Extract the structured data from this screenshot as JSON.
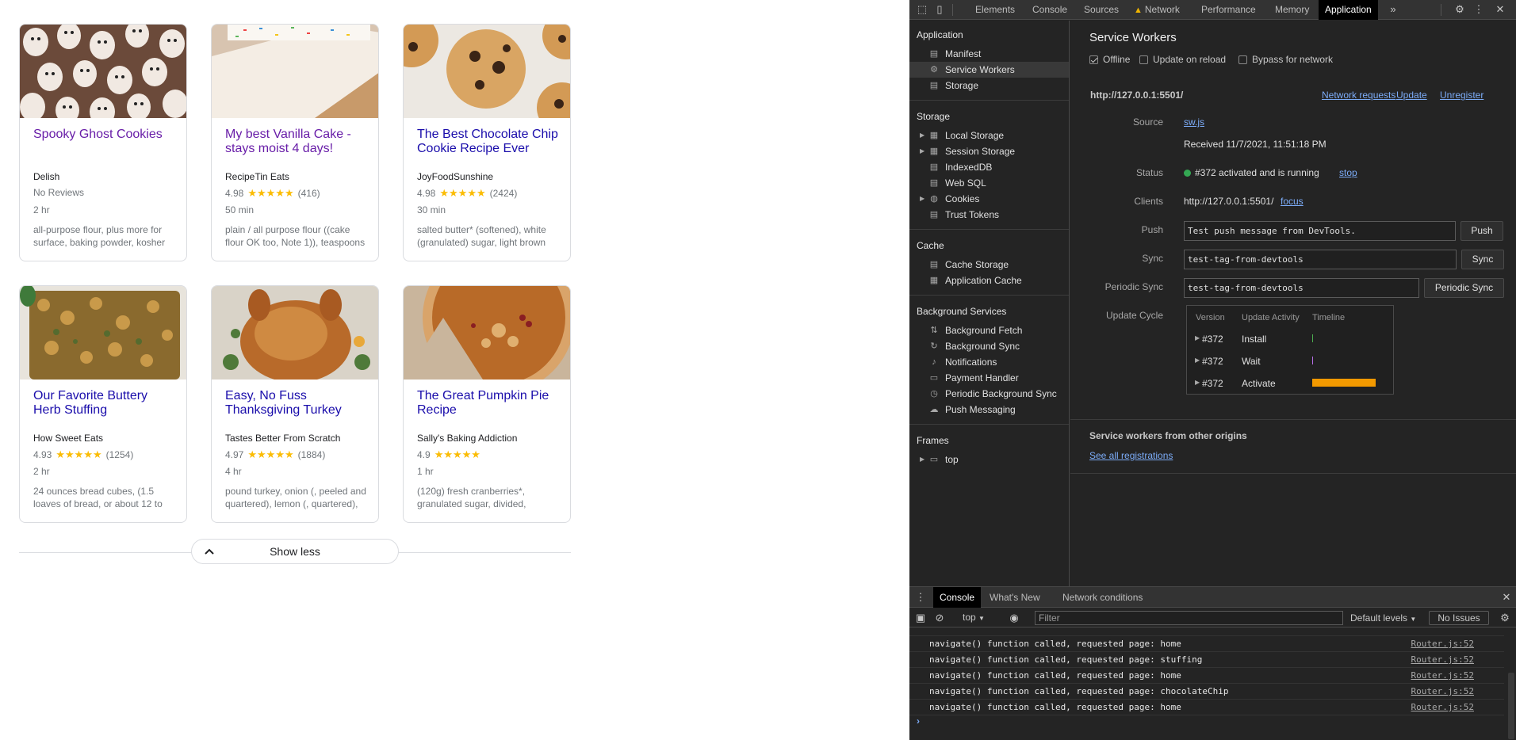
{
  "cards": [
    {
      "title": "Spooky Ghost Cookies",
      "source": "Delish",
      "rating_text": "No Reviews",
      "rating": "",
      "stars": "",
      "reviews": "",
      "time": "2 hr",
      "ingredients": "all-purpose flour, plus more for surface, baking powder, kosher",
      "visited": true
    },
    {
      "title": "My best Vanilla Cake - stays moist 4 days!",
      "source": "RecipeTin Eats",
      "rating": "4.98",
      "stars": "★★★★★",
      "reviews": "(416)",
      "time": "50 min",
      "ingredients": "plain / all purpose flour ((cake flour OK too, Note 1)), teaspoons",
      "visited": true
    },
    {
      "title": "The Best Chocolate Chip Cookie Recipe Ever",
      "source": "JoyFoodSunshine",
      "rating": "4.98",
      "stars": "★★★★★",
      "reviews": "(2424)",
      "time": "30 min",
      "ingredients": "salted butter* (softened), white (granulated) sugar, light brown",
      "visited": false
    },
    {
      "title": "Our Favorite Buttery Herb Stuffing",
      "source": "How Sweet Eats",
      "rating": "4.93",
      "stars": "★★★★★",
      "reviews": "(1254)",
      "time": "2 hr",
      "ingredients": "24 ounces bread cubes, (1.5 loaves of bread, or about 12 to",
      "visited": false
    },
    {
      "title": "Easy, No Fuss Thanksgiving Turkey",
      "source": "Tastes Better From Scratch",
      "rating": "4.97",
      "stars": "★★★★★",
      "reviews": "(1884)",
      "time": "4 hr",
      "ingredients": "pound turkey, onion (, peeled and quartered), lemon (, quartered),",
      "visited": false
    },
    {
      "title": "The Great Pumpkin Pie Recipe",
      "source": "Sally's Baking Addiction",
      "rating": "4.9",
      "stars": "★★★★★",
      "reviews": "",
      "time": "1 hr",
      "ingredients": "(120g) fresh cranberries*, granulated sugar, divided,",
      "visited": false
    }
  ],
  "show_less": "Show less",
  "devtools": {
    "tabs": [
      "Elements",
      "Console",
      "Sources",
      "Network",
      "Performance",
      "Memory",
      "Application"
    ],
    "sidebar": {
      "application_header": "Application",
      "application_items": [
        "Manifest",
        "Service Workers",
        "Storage"
      ],
      "storage_header": "Storage",
      "storage_items": [
        "Local Storage",
        "Session Storage",
        "IndexedDB",
        "Web SQL",
        "Cookies",
        "Trust Tokens"
      ],
      "cache_header": "Cache",
      "cache_items": [
        "Cache Storage",
        "Application Cache"
      ],
      "bg_header": "Background Services",
      "bg_items": [
        "Background Fetch",
        "Background Sync",
        "Notifications",
        "Payment Handler",
        "Periodic Background Sync",
        "Push Messaging"
      ],
      "frames_header": "Frames",
      "frames_items": [
        "top"
      ]
    },
    "sw": {
      "title": "Service Workers",
      "offline": "Offline",
      "update_on_reload": "Update on reload",
      "bypass": "Bypass for network",
      "origin": "http://127.0.0.1:5501/",
      "network_requests": "Network requests",
      "update": "Update",
      "unregister": "Unregister",
      "source_label": "Source",
      "source_file": "sw.js",
      "received": "Received 11/7/2021, 11:51:18 PM",
      "status_label": "Status",
      "status_text": "#372 activated and is running",
      "stop": "stop",
      "clients_label": "Clients",
      "clients_url": "http://127.0.0.1:5501/",
      "focus": "focus",
      "push_label": "Push",
      "push_value": "Test push message from DevTools.",
      "push_button": "Push",
      "sync_label": "Sync",
      "sync_value": "test-tag-from-devtools",
      "sync_button": "Sync",
      "psync_label": "Periodic Sync",
      "psync_value": "test-tag-from-devtools",
      "psync_button": "Periodic Sync",
      "cycle_label": "Update Cycle",
      "cycle_headers": [
        "Version",
        "Update Activity",
        "Timeline"
      ],
      "cycle_rows": [
        {
          "version": "#372",
          "activity": "Install"
        },
        {
          "version": "#372",
          "activity": "Wait"
        },
        {
          "version": "#372",
          "activity": "Activate"
        }
      ],
      "other_origins": "Service workers from other origins",
      "see_all": "See all registrations"
    },
    "drawer": {
      "tabs": [
        "Console",
        "What's New",
        "Network conditions"
      ],
      "context": "top",
      "filter_placeholder": "Filter",
      "levels": "Default levels",
      "issues": "No Issues",
      "lines": [
        {
          "msg": "navigate() function called, requested page: home",
          "src": "Router.js:52"
        },
        {
          "msg": "navigate() function called, requested page: stuffing",
          "src": "Router.js:52"
        },
        {
          "msg": "navigate() function called, requested page: home",
          "src": "Router.js:52"
        },
        {
          "msg": "navigate() function called, requested page: chocolateChip",
          "src": "Router.js:52"
        },
        {
          "msg": "navigate() function called, requested page: home",
          "src": "Router.js:52"
        }
      ]
    },
    "colors": {
      "accent_bar": "#f29900",
      "status_dot": "#34a853",
      "install_tick": "#4caf50",
      "wait_tick": "#b86ee8"
    }
  }
}
